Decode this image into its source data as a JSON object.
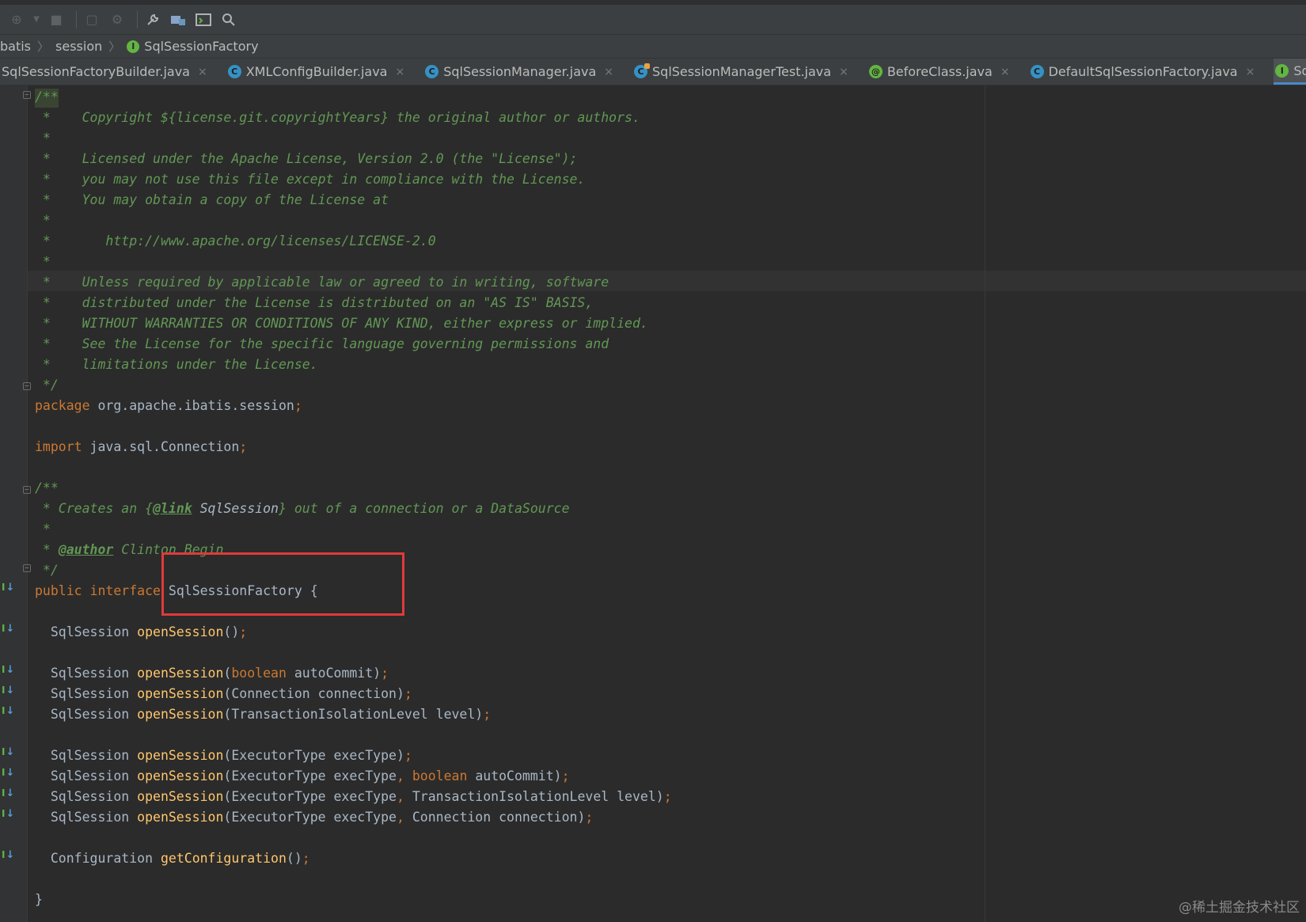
{
  "toolbar": {
    "buttons": [
      "run-with-coverage-icon",
      "dropdown-arrow-icon",
      "stop-icon",
      "build-icon",
      "debug-icon",
      "wrench-icon",
      "project-structure-icon",
      "terminal-icon",
      "search-icon"
    ]
  },
  "breadcrumb": {
    "items": [
      "batis",
      "session"
    ],
    "current": "SqlSessionFactory"
  },
  "tabs": [
    {
      "label": "SqlSessionFactoryBuilder.java",
      "icon": "class-icon",
      "close": "×"
    },
    {
      "label": "XMLConfigBuilder.java",
      "icon": "class-icon",
      "close": "×"
    },
    {
      "label": "SqlSessionManager.java",
      "icon": "class-icon",
      "close": "×"
    },
    {
      "label": "SqlSessionManagerTest.java",
      "icon": "test-class-icon",
      "close": "×"
    },
    {
      "label": "BeforeClass.java",
      "icon": "annotation-icon",
      "close": "×"
    },
    {
      "label": "DefaultSqlSessionFactory.java",
      "icon": "class-icon",
      "close": "×"
    },
    {
      "label": "SqlSessionFactory.java",
      "icon": "interface-icon",
      "close": "×",
      "active": true
    }
  ],
  "code": {
    "c1": "/**",
    "c2": " *    Copyright ${license.git.copyrightYears} the original author or authors.",
    "c3": " *",
    "c4": " *    Licensed under the Apache License, Version 2.0 (the \"License\");",
    "c5": " *    you may not use this file except in compliance with the License.",
    "c6": " *    You may obtain a copy of the License at",
    "c7": " *",
    "c8": " *       http://www.apache.org/licenses/LICENSE-2.0",
    "c9": " *",
    "c10": " *    Unless required by applicable law or agreed to in writing, software",
    "c11": " *    distributed under the License is distributed on an \"AS IS\" BASIS,",
    "c12": " *    WITHOUT WARRANTIES OR CONDITIONS OF ANY KIND, either express or implied.",
    "c13": " *    See the License for the specific language governing permissions and",
    "c14": " *    limitations under the License.",
    "c15": " */",
    "kw_package": "package",
    "package_name": " org.apache.ibatis.session",
    "semi": ";",
    "kw_import": "import",
    "import_name": " java.sql.Connection",
    "doc_open": "/**",
    "doc_l1_a": " * Creates an {",
    "doc_l1_tag": "@link",
    "doc_l1_ref": " SqlSession",
    "doc_l1_b": "} out of a connection or a DataSource",
    "doc_l2": " *",
    "doc_l3_a": " * ",
    "doc_l3_tag": "@author",
    "doc_l3_b": " Clinton Begin",
    "doc_close": " */",
    "kw_public": "public",
    "kw_interface": " interface",
    "iface_name": " SqlSessionFactory {",
    "ret_type": "  SqlSession ",
    "method": "openSession",
    "m1_args": "()",
    "m2_open": "(",
    "m2_kw": "boolean",
    "m2_rest": " autoCommit)",
    "m3_args": "(Connection connection)",
    "m4_args": "(TransactionIsolationLevel level)",
    "m5_args": "(ExecutorType execType)",
    "m6_a": "(ExecutorType execType",
    "comma": ",",
    "m6_kw": " boolean",
    "m6_b": " autoCommit)",
    "m7_a": "(ExecutorType execType",
    "m7_b": " TransactionIsolationLevel level)",
    "m8_a": "(ExecutorType execType",
    "m8_b": " Connection connection)",
    "cfg_type": "  Configuration ",
    "cfg_method": "getConfiguration",
    "cfg_args": "()",
    "close_brace": "}"
  },
  "watermark": "@稀土掘金技术社区",
  "colors": {
    "keyword": "#cc7832",
    "comment": "#629755",
    "method": "#ffc66d",
    "text": "#a9b7c6",
    "highlight_box": "#e03a3a"
  }
}
